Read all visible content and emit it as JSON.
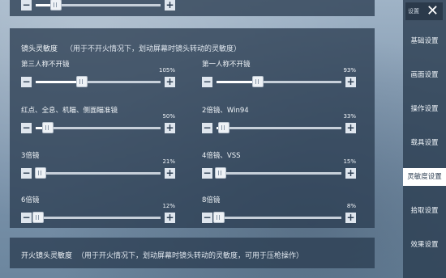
{
  "sidebar": {
    "close_label": "设置",
    "items": [
      {
        "label": "基础设置"
      },
      {
        "label": "画面设置"
      },
      {
        "label": "操作设置"
      },
      {
        "label": "载具设置"
      },
      {
        "label": "灵敏度设置",
        "active": true
      },
      {
        "label": "拾取设置"
      },
      {
        "label": "效果设置"
      }
    ]
  },
  "main": {
    "title": "镜头灵敏度",
    "note": "（用于不开火情况下，划动屏幕时镜头转动的灵敏度）",
    "sliders": [
      {
        "label": "第三人称不开镜",
        "value": "105%",
        "level": 0.37
      },
      {
        "label": "第一人称不开镜",
        "value": "93%",
        "level": 0.33
      },
      {
        "label": "红点、全息、机瞄、侧面瞄准镜",
        "value": "50%",
        "level": 0.1
      },
      {
        "label": "2倍镜、Win94",
        "value": "33%",
        "level": 0.06
      },
      {
        "label": "3倍镜",
        "value": "21%",
        "level": 0.04
      },
      {
        "label": "4倍镜、VSS",
        "value": "15%",
        "level": 0.03
      },
      {
        "label": "6倍镜",
        "value": "12%",
        "level": 0.02
      },
      {
        "label": "8倍镜",
        "value": "8%",
        "level": 0.02
      }
    ]
  },
  "bottom": {
    "title": "开火镜头灵敏度",
    "note": "（用于开火情况下，划动屏幕时镜头转动的灵敏度，可用于压枪操作）"
  },
  "top_slider": {
    "level": 0.16
  }
}
